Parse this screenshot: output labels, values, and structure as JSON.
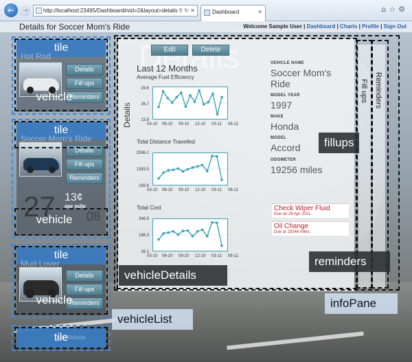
{
  "browser": {
    "url": "http://localhost:23495/Dashboard#vid=2&layout=details",
    "tab_title": "Dashboard",
    "back_icon": "back-arrow-icon",
    "forward_icon": "forward-arrow-icon",
    "toolbar_icons": [
      "home-icon",
      "star-icon",
      "gear-icon"
    ]
  },
  "header": {
    "title": "Details for Soccer Mom's Ride",
    "welcome": "Welcome Sample User",
    "links": [
      "Dashboard",
      "Charts",
      "Profile",
      "Sign Out"
    ]
  },
  "vehicle_list": {
    "label": "vehicleList",
    "tiles": [
      {
        "tile_label": "tile",
        "sub_text": "Hot Rod",
        "overlay_label": "vehicle",
        "buttons": [
          "Details",
          "Fill ups",
          "Reminders"
        ]
      },
      {
        "tile_label": "tile",
        "sub_text": "Soccer Mom's Ride",
        "overlay_label": "vehicle",
        "buttons": [
          "Details",
          "Fill ups",
          "Reminders"
        ],
        "cost_big": "27",
        "cost_cents": "13¢",
        "cost_per": "per mile",
        "ghost": "08"
      },
      {
        "tile_label": "tile",
        "sub_text": "Mud Lover",
        "overlay_label": "vehicle",
        "buttons": [
          "Details",
          "Fill ups",
          "Reminders"
        ]
      },
      {
        "tile_label": "tile",
        "sub_text": "Add Vehicle"
      }
    ]
  },
  "details": {
    "bg_text": "Details",
    "edit_label": "Edit",
    "delete_label": "Delete",
    "side_label": "Details",
    "section_title": "Last 12 Months",
    "overlay_label": "vehicleDetails",
    "charts": [
      {
        "title": "Average Fuel Efficiency",
        "yticks": [
          "29.6",
          "26.7",
          "23.8"
        ]
      },
      {
        "title": "Total Distance Travelled",
        "yticks": [
          "2596.2",
          "1383.0",
          "169.8"
        ]
      },
      {
        "title": "Total Cost",
        "yticks": [
          "346.6",
          "186.3",
          "26.1"
        ]
      }
    ],
    "xticks": [
      "03-10",
      "06-10",
      "09-10",
      "12-10",
      "03-11",
      "06-11"
    ],
    "info": {
      "name_key": "VEHICLE NAME",
      "name_val": "Soccer Mom's Ride",
      "year_key": "MODEL YEAR",
      "year_val": "1997",
      "make_key": "MAKE",
      "make_val": "Honda",
      "model_key": "MODEL",
      "model_val": "Accord",
      "odometer_key": "ODOMETER",
      "odometer_val": "19256 miles"
    },
    "reminders": [
      {
        "title": "Check Wiper Fluid",
        "due": "Due on 29 Apr 2011."
      },
      {
        "title": "Oil Change",
        "due": "Due at 19246 miles."
      }
    ]
  },
  "side_tabs": {
    "fillups": "Fill ups",
    "reminders": "Reminders"
  },
  "overlay_labels": {
    "fillups": "fillups",
    "reminders": "reminders",
    "info_pane": "infoPane"
  },
  "chart_data": [
    {
      "type": "line",
      "title": "Average Fuel Efficiency",
      "x": [
        "03-10",
        "04-10",
        "05-10",
        "06-10",
        "07-10",
        "08-10",
        "09-10",
        "10-10",
        "11-10",
        "12-10",
        "01-11",
        "02-11",
        "03-11",
        "04-11",
        "05-11"
      ],
      "values": [
        25.8,
        29.3,
        27.8,
        26.8,
        28.0,
        29.0,
        25.9,
        28.4,
        27.0,
        29.5,
        26.4,
        26.9,
        28.8,
        24.2,
        28.0
      ],
      "ylim": [
        23.8,
        29.6
      ]
    },
    {
      "type": "line",
      "title": "Total Distance Travelled",
      "x": [
        "04-10",
        "05-10",
        "06-10",
        "07-10",
        "08-10",
        "09-10",
        "10-10",
        "11-10",
        "12-10",
        "01-11",
        "02-11",
        "03-11",
        "04-11",
        "05-11"
      ],
      "values": [
        500,
        1050,
        1250,
        1300,
        1420,
        1150,
        1350,
        1520,
        1620,
        1760,
        1180,
        2596,
        2550,
        380
      ],
      "ylim": [
        169.8,
        2596.2
      ]
    },
    {
      "type": "line",
      "title": "Total Cost",
      "x": [
        "04-10",
        "05-10",
        "06-10",
        "07-10",
        "08-10",
        "09-10",
        "10-10",
        "11-10",
        "12-10",
        "01-11",
        "02-11",
        "03-11",
        "04-11",
        "05-11"
      ],
      "values": [
        130,
        205,
        215,
        230,
        190,
        235,
        240,
        170,
        230,
        250,
        170,
        340,
        335,
        55
      ],
      "ylim": [
        26.1,
        346.6
      ]
    }
  ]
}
